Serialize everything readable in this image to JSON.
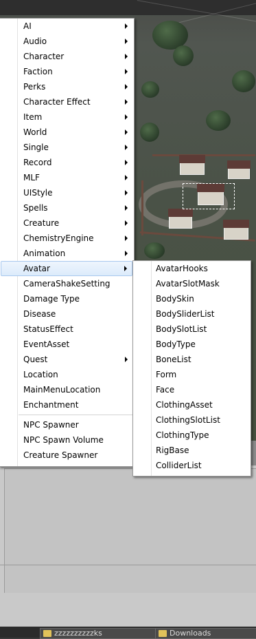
{
  "main_menu": {
    "items": [
      {
        "label": "AI",
        "submenu": true
      },
      {
        "label": "Audio",
        "submenu": true
      },
      {
        "label": "Character",
        "submenu": true
      },
      {
        "label": "Faction",
        "submenu": true
      },
      {
        "label": "Perks",
        "submenu": true
      },
      {
        "label": "Character Effect",
        "submenu": true
      },
      {
        "label": "Item",
        "submenu": true
      },
      {
        "label": "World",
        "submenu": true
      },
      {
        "label": "Single",
        "submenu": true
      },
      {
        "label": "Record",
        "submenu": true
      },
      {
        "label": "MLF",
        "submenu": true
      },
      {
        "label": "UIStyle",
        "submenu": true
      },
      {
        "label": "Spells",
        "submenu": true
      },
      {
        "label": "Creature",
        "submenu": true
      },
      {
        "label": "ChemistryEngine",
        "submenu": true
      },
      {
        "label": "Animation",
        "submenu": true
      },
      {
        "label": "Avatar",
        "submenu": true,
        "highlighted": true
      },
      {
        "label": "CameraShakeSetting",
        "submenu": false
      },
      {
        "label": "Damage Type",
        "submenu": false
      },
      {
        "label": "Disease",
        "submenu": false
      },
      {
        "label": "StatusEffect",
        "submenu": false
      },
      {
        "label": "EventAsset",
        "submenu": false
      },
      {
        "label": "Quest",
        "submenu": true
      },
      {
        "label": "Location",
        "submenu": false
      },
      {
        "label": "MainMenuLocation",
        "submenu": false
      },
      {
        "label": "Enchantment",
        "submenu": false
      }
    ],
    "spawner_items": [
      {
        "label": "NPC Spawner"
      },
      {
        "label": "NPC Spawn Volume"
      },
      {
        "label": "Creature Spawner"
      }
    ]
  },
  "avatar_submenu": {
    "items": [
      "AvatarHooks",
      "AvatarSlotMask",
      "BodySkin",
      "BodySliderList",
      "BodySlotList",
      "BodyType",
      "BoneList",
      "Form",
      "Face",
      "ClothingAsset",
      "ClothingSlotList",
      "ClothingType",
      "RigBase",
      "ColliderList"
    ]
  },
  "taskbar": {
    "buttons": [
      {
        "label": "zzzzzzzzzzks",
        "icon": "folder-icon"
      },
      {
        "label": "Downloads",
        "icon": "folder-icon"
      }
    ]
  },
  "colors": {
    "highlight_border": "#a8c8ee",
    "highlight_fill": "#dcebfb",
    "menu_bg": "#ffffff"
  }
}
